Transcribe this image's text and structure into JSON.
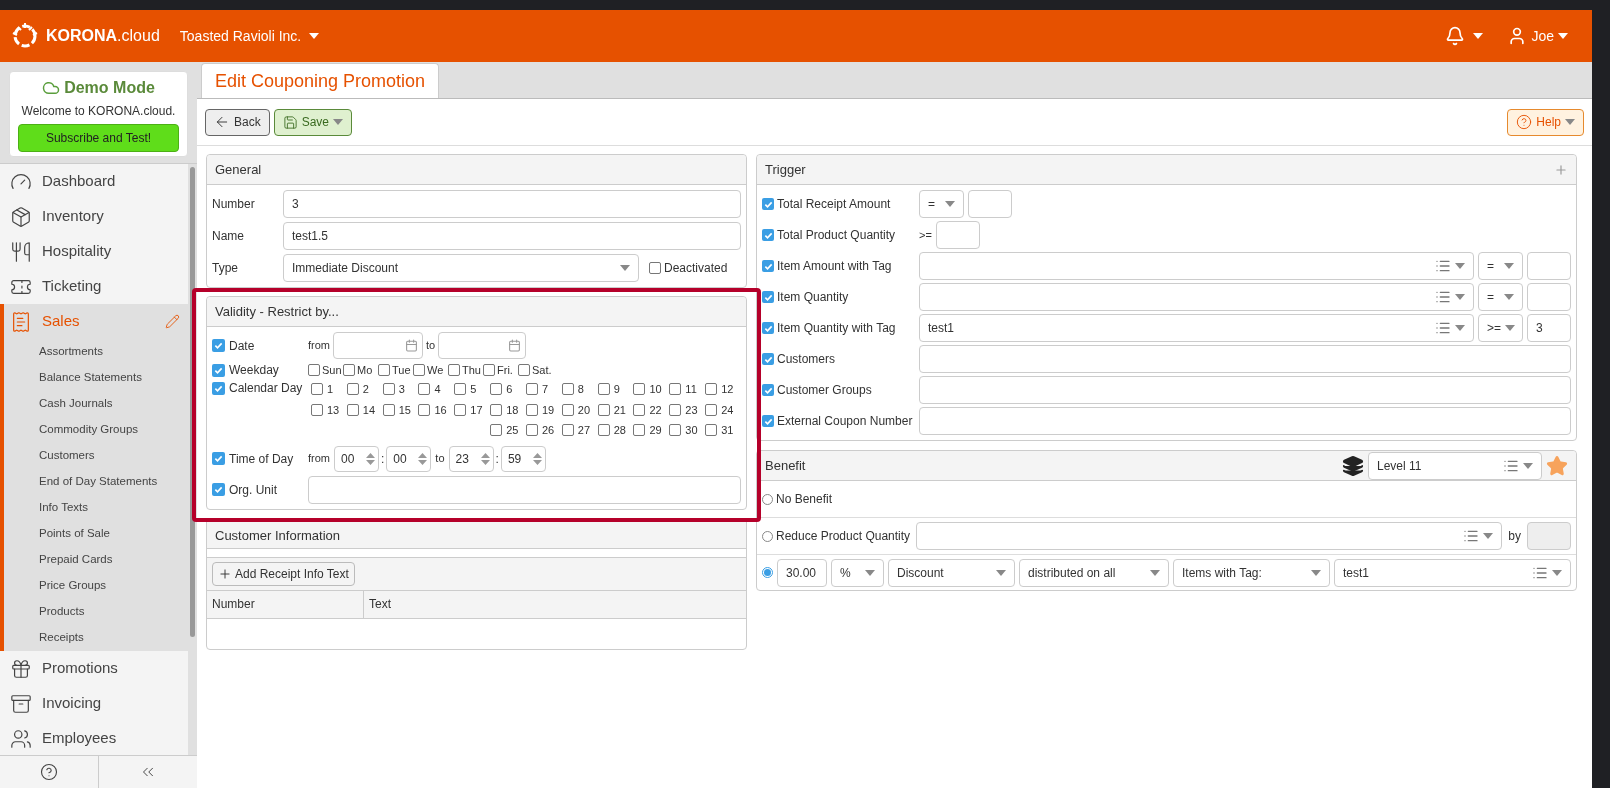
{
  "topbar": {
    "brand": "**KORONA**.cloud",
    "company": "Toasted Ravioli Inc.",
    "user": "Joe"
  },
  "demo": {
    "title": "Demo Mode",
    "welcome": "Welcome to KORONA.cloud.",
    "button": "Subscribe and Test!"
  },
  "sidebar": {
    "items": [
      {
        "label": "Dashboard",
        "selected": false
      },
      {
        "label": "Inventory",
        "selected": false
      },
      {
        "label": "Hospitality",
        "selected": false
      },
      {
        "label": "Ticketing",
        "selected": false
      },
      {
        "label": "Sales",
        "selected": true,
        "children": [
          {
            "label": "Assortments"
          },
          {
            "label": "Balance Statements"
          },
          {
            "label": "Cash Journals"
          },
          {
            "label": "Commodity Groups"
          },
          {
            "label": "Customers"
          },
          {
            "label": "End of Day Statements"
          },
          {
            "label": "Info Texts"
          },
          {
            "label": "Points of Sale"
          },
          {
            "label": "Prepaid Cards"
          },
          {
            "label": "Price Groups"
          },
          {
            "label": "Products"
          },
          {
            "label": "Receipts"
          }
        ]
      },
      {
        "label": "Promotions",
        "selected": false
      },
      {
        "label": "Invoicing",
        "selected": false
      },
      {
        "label": "Employees",
        "selected": false
      }
    ]
  },
  "page_tab": {
    "title": "Edit Couponing Promotion"
  },
  "toolbar": {
    "back": "Back",
    "save": "Save",
    "help": "Help"
  },
  "general": {
    "title": "General",
    "fields": [
      {
        "label": "Number",
        "value": "3"
      },
      {
        "label": "Name",
        "value": "test1.5"
      }
    ],
    "type": {
      "label": "Type",
      "value": "Immediate Discount"
    },
    "deactivated": {
      "label": "Deactivated",
      "checked": false
    }
  },
  "validity": {
    "title": "Validity - Restrict by...",
    "date": {
      "label": "Date",
      "checked": true,
      "from_label": "from",
      "to_label": "to"
    },
    "weekday": {
      "label": "Weekday",
      "checked": true,
      "days": [
        {
          "label": "Sun",
          "checked": false
        },
        {
          "label": "Mo",
          "checked": false
        },
        {
          "label": "Tue",
          "checked": false
        },
        {
          "label": "We",
          "checked": false
        },
        {
          "label": "Thu",
          "checked": false
        },
        {
          "label": "Fri.",
          "checked": false
        },
        {
          "label": "Sat.",
          "checked": false
        }
      ]
    },
    "calendar_day": {
      "label": "Calendar Day",
      "checked": true,
      "days": [
        {
          "label": "1",
          "checked": false
        },
        {
          "label": "2",
          "checked": false
        },
        {
          "label": "3",
          "checked": false
        },
        {
          "label": "4",
          "checked": false
        },
        {
          "label": "5",
          "checked": false
        },
        {
          "label": "6",
          "checked": false
        },
        {
          "label": "7",
          "checked": false
        },
        {
          "label": "8",
          "checked": false
        },
        {
          "label": "9",
          "checked": false
        },
        {
          "label": "10",
          "checked": false
        },
        {
          "label": "11",
          "checked": false
        },
        {
          "label": "12",
          "checked": false
        },
        {
          "label": "13",
          "checked": false
        },
        {
          "label": "14",
          "checked": false
        },
        {
          "label": "15",
          "checked": false
        },
        {
          "label": "16",
          "checked": false
        },
        {
          "label": "17",
          "checked": false
        },
        {
          "label": "18",
          "checked": false
        },
        {
          "label": "19",
          "checked": false
        },
        {
          "label": "20",
          "checked": false
        },
        {
          "label": "21",
          "checked": false
        },
        {
          "label": "22",
          "checked": false
        },
        {
          "label": "23",
          "checked": false
        },
        {
          "label": "24",
          "checked": false
        },
        {
          "label": "25",
          "checked": false
        },
        {
          "label": "26",
          "checked": false
        },
        {
          "label": "27",
          "checked": false
        },
        {
          "label": "28",
          "checked": false
        },
        {
          "label": "29",
          "checked": false
        },
        {
          "label": "30",
          "checked": false
        },
        {
          "label": "31",
          "checked": false
        }
      ]
    },
    "time": {
      "label": "Time of Day",
      "checked": true,
      "from_label": "from",
      "to_label": "to",
      "separator": ":",
      "from_hour": "00",
      "from_minute": "00",
      "to_hour": "23",
      "to_minute": "59"
    },
    "org_unit": {
      "label": "Org. Unit",
      "checked": true
    }
  },
  "customer_information": {
    "title": "Customer Information"
  },
  "receipt_info": {
    "add_button": "Add Receipt Info Text",
    "columns": [
      "Number",
      "Text"
    ]
  },
  "trigger": {
    "title": "Trigger",
    "rows": [
      {
        "kind": "compare",
        "label": "Total Receipt Amount",
        "checked": true,
        "operator": "="
      },
      {
        "kind": "fixed",
        "label": "Total Product Quantity",
        "checked": true,
        "operator": ">="
      },
      {
        "kind": "tag",
        "label": "Item Amount with Tag",
        "checked": true,
        "operator": "="
      },
      {
        "kind": "tag",
        "label": "Item Quantity",
        "checked": true,
        "operator": "="
      },
      {
        "kind": "tag",
        "label": "Item Quantity with Tag",
        "checked": true,
        "operator": ">=",
        "tag": "test1",
        "value": "3"
      },
      {
        "kind": "field",
        "label": "Customers",
        "checked": true
      },
      {
        "kind": "field",
        "label": "Customer Groups",
        "checked": true
      },
      {
        "kind": "field",
        "label": "External Coupon Number",
        "checked": true
      }
    ]
  },
  "benefit": {
    "title": "Benefit",
    "level": "Level 11",
    "options": [
      {
        "kind": "none",
        "label": "No Benefit",
        "selected": false
      },
      {
        "kind": "reduce",
        "label": "Reduce Product Quantity",
        "by_label": "by",
        "selected": false
      },
      {
        "kind": "discount",
        "selected": true,
        "amount": "30.00",
        "unit": "%",
        "type": "Discount",
        "distribution": "distributed on all",
        "target": "Items with Tag:",
        "tag": "test1"
      }
    ]
  }
}
